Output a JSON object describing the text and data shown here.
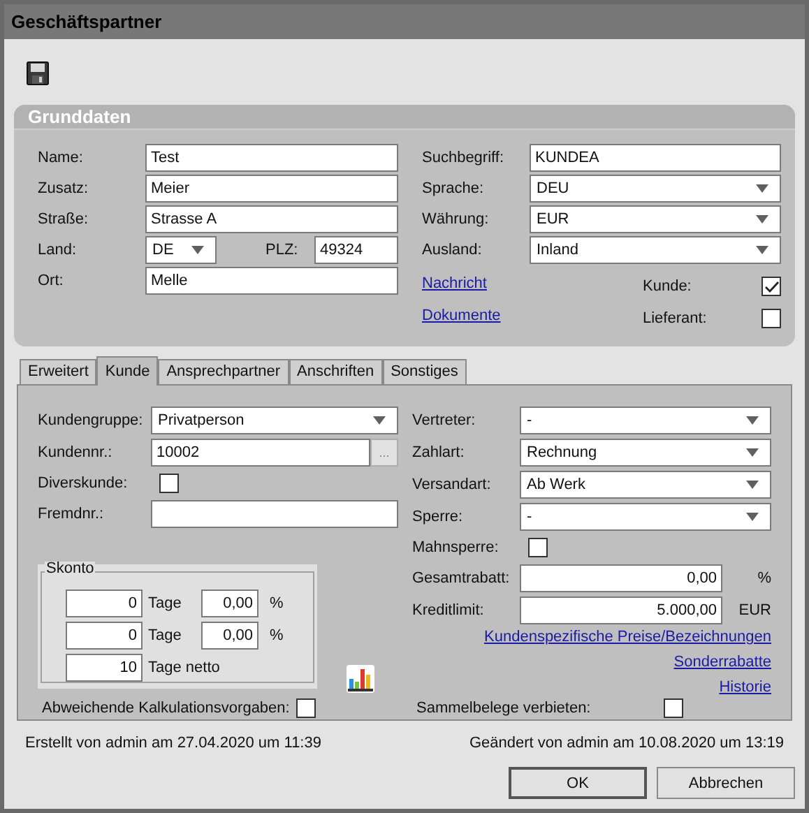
{
  "window": {
    "title": "Geschäftspartner"
  },
  "grunddaten": {
    "title": "Grunddaten",
    "left": [
      {
        "kind": "text",
        "label": "Name:",
        "value": "Test"
      },
      {
        "kind": "text",
        "label": "Zusatz:",
        "value": "Meier"
      },
      {
        "kind": "text",
        "label": "Straße:",
        "value": "Strasse A"
      },
      {
        "kind": "land",
        "label": "Land:",
        "value": "DE",
        "plz_label": "PLZ:",
        "plz": "49324"
      },
      {
        "kind": "text",
        "label": "Ort:",
        "value": "Melle"
      }
    ],
    "right": [
      {
        "kind": "text",
        "label": "Suchbegriff:",
        "value": "KUNDEA"
      },
      {
        "kind": "select",
        "label": "Sprache:",
        "value": "DEU"
      },
      {
        "kind": "select",
        "label": "Währung:",
        "value": "EUR"
      },
      {
        "kind": "select",
        "label": "Ausland:",
        "value": "Inland"
      }
    ],
    "links": [
      "Nachricht",
      "Dokumente"
    ],
    "checks": [
      {
        "label": "Kunde:",
        "checked": true
      },
      {
        "label": "Lieferant:",
        "checked": false
      }
    ]
  },
  "tabs": [
    {
      "label": "Erweitert",
      "selected": false
    },
    {
      "label": "Kunde",
      "selected": true
    },
    {
      "label": "Ansprechpartner",
      "selected": false
    },
    {
      "label": "Anschriften",
      "selected": false
    },
    {
      "label": "Sonstiges",
      "selected": false
    }
  ],
  "kunde": {
    "left": [
      {
        "kind": "select",
        "label": "Kundengruppe:",
        "value": "Privatperson"
      },
      {
        "kind": "lookup",
        "label": "Kundennr.:",
        "value": "10002",
        "button": "..."
      },
      {
        "kind": "checkbox",
        "label": "Diverskunde:",
        "checked": false
      },
      {
        "kind": "text",
        "label": "Fremdnr.:"
      }
    ],
    "right": [
      {
        "kind": "select",
        "label": "Vertreter:",
        "value": "-"
      },
      {
        "kind": "select",
        "label": "Zahlart:",
        "value": "Rechnung"
      },
      {
        "kind": "select",
        "label": "Versandart:",
        "value": "Ab Werk"
      },
      {
        "kind": "select",
        "label": "Sperre:",
        "value": "-"
      },
      {
        "kind": "checkbox",
        "label": "Mahnsperre:",
        "checked": false
      },
      {
        "kind": "number",
        "label": "Gesamtrabatt:",
        "value": "0,00",
        "unit": "%"
      },
      {
        "kind": "number",
        "label": "Kreditlimit:",
        "value": "5.000,00",
        "unit": "EUR"
      }
    ],
    "links": [
      "Kundenspezifische Preise/Bezeichnungen",
      "Sonderrabatte",
      "Historie"
    ],
    "skonto": {
      "title": "Skonto",
      "rows": [
        {
          "days": "0",
          "days_label": "Tage",
          "percent": "0,00",
          "unit": "%"
        },
        {
          "days": "0",
          "days_label": "Tage",
          "percent": "0,00",
          "unit": "%"
        },
        {
          "days": "10",
          "days_label": "Tage netto"
        }
      ]
    },
    "bottom_checks": [
      {
        "label": "Abweichende Kalkulationsvorgaben:",
        "checked": false
      },
      {
        "label": "Sammelbelege verbieten:",
        "checked": false
      }
    ]
  },
  "footer": {
    "created": "Erstellt von admin am 27.04.2020 um 11:39",
    "changed": "Geändert von admin am 10.08.2020 um 13:19"
  },
  "buttons": [
    {
      "label": "OK",
      "default": true
    },
    {
      "label": "Abbrechen",
      "default": false
    }
  ]
}
